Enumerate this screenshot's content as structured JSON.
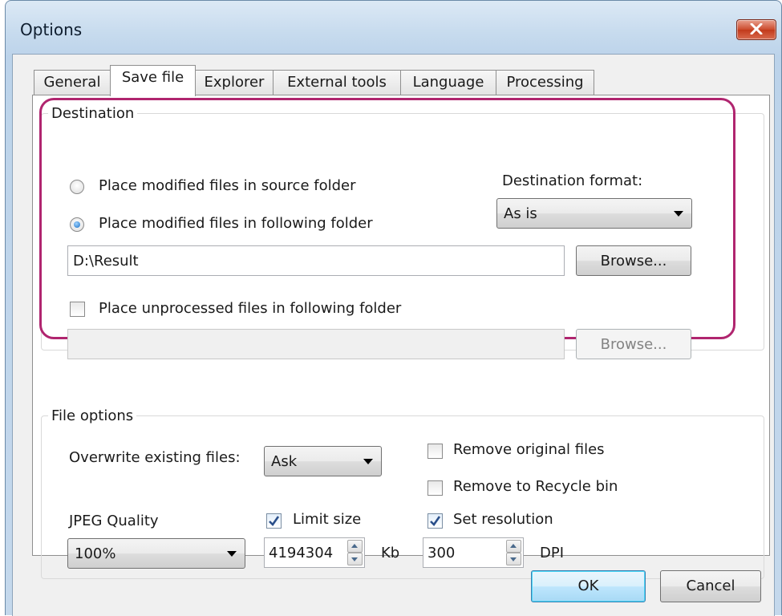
{
  "window": {
    "title": "Options",
    "close_icon": "close-icon",
    "close_color": "#c9462a"
  },
  "tabs": [
    {
      "label": "General",
      "active": false
    },
    {
      "label": "Save file",
      "active": true
    },
    {
      "label": "Explorer",
      "active": false
    },
    {
      "label": "External tools",
      "active": false
    },
    {
      "label": "Language",
      "active": false
    },
    {
      "label": "Processing",
      "active": false
    }
  ],
  "destination": {
    "legend": "Destination",
    "highlight_color": "#b0256f",
    "radio_source_label": "Place modified files in source folder",
    "radio_source_checked": false,
    "radio_folder_label": "Place modified files in following folder",
    "radio_folder_checked": true,
    "format_label": "Destination format:",
    "format_value": "As is",
    "folder_path": "D:\\Result",
    "browse_label": "Browse...",
    "unprocessed_label": "Place unprocessed files in following folder",
    "unprocessed_checked": false,
    "unprocessed_path": "",
    "browse2_label": "Browse..."
  },
  "file_options": {
    "legend": "File options",
    "overwrite_label": "Overwrite existing files:",
    "overwrite_value": "Ask",
    "remove_original_label": "Remove original files",
    "remove_original_checked": false,
    "recycle_label": "Remove to Recycle bin",
    "recycle_checked": false,
    "jpeg_label": "JPEG Quality",
    "jpeg_value": "100%",
    "limit_size_label": "Limit size",
    "limit_size_checked": true,
    "limit_size_value": "4194304",
    "limit_size_unit": "Kb",
    "set_resolution_label": "Set resolution",
    "set_resolution_checked": true,
    "resolution_value": "300",
    "resolution_unit": "DPI"
  },
  "footer": {
    "ok_label": "OK",
    "cancel_label": "Cancel"
  }
}
